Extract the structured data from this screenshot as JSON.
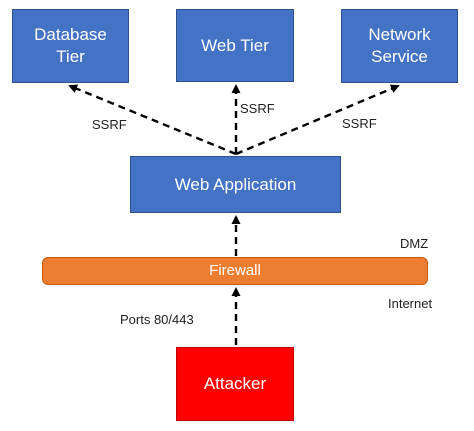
{
  "nodes": {
    "database_tier": "Database\nTier",
    "web_tier": "Web Tier",
    "network_service": "Network\nService",
    "web_application": "Web Application",
    "firewall": "Firewall",
    "attacker": "Attacker"
  },
  "edge_labels": {
    "ssrf_left": "SSRF",
    "ssrf_center": "SSRF",
    "ssrf_right": "SSRF",
    "ports": "Ports 80/443"
  },
  "zones": {
    "dmz": "DMZ",
    "internet": "Internet"
  },
  "colors": {
    "tier_box": "#4472c4",
    "firewall": "#ed7d31",
    "attacker": "#ff0000",
    "arrow": "#000000"
  }
}
